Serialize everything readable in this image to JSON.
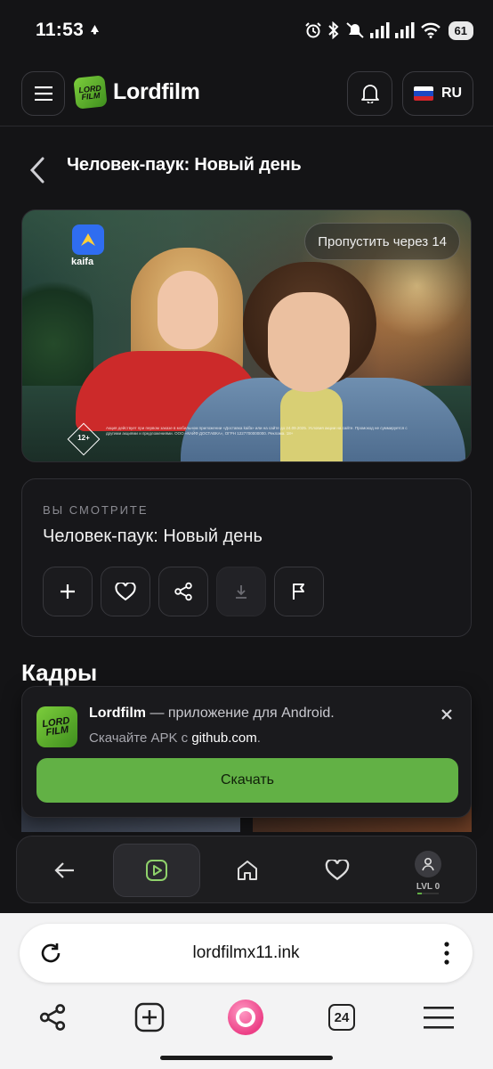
{
  "status_bar": {
    "time": "11:53",
    "battery": "61"
  },
  "header": {
    "logo_text": "Lordfilm",
    "logo_badge_line1": "LORD",
    "logo_badge_line2": "FILM",
    "language": "RU"
  },
  "page": {
    "title": "Человек-паук: Новый день"
  },
  "ad": {
    "brand": "kaifa",
    "skip_label": "Пропустить через 14",
    "age_rating": "12+",
    "disclaimer": "Акция действует при первом заказе в мобильном приложении «Доставка kaifa» или на сайте до 24.09.2025. Условия акции на сайте. Промокод не суммируется с другими акциями и предложениями. ООО «КАЙФ ДОСТАВКА», ОГРН 1227700000000. Реклама. 18+"
  },
  "watching": {
    "label": "ВЫ СМОТРИТЕ",
    "title": "Человек-паук: Новый день",
    "actions": [
      "add",
      "favorite",
      "share",
      "download",
      "report"
    ]
  },
  "frames": {
    "heading": "Кадры"
  },
  "app_banner": {
    "app_name": "Lordfilm",
    "tagline": " — приложение для Android.",
    "source_prefix": "Скачайте APK с ",
    "source": "github.com",
    "source_suffix": ".",
    "download_label": "Скачать"
  },
  "bottom_nav": {
    "items": [
      "back",
      "player",
      "home",
      "favorites",
      "profile"
    ],
    "active": "player",
    "level_label": "LVL 0",
    "level_progress": 0.2
  },
  "browser": {
    "url": "lordfilmx11.ink",
    "tabs_count": "24"
  },
  "colors": {
    "accent_green": "#62b145",
    "background": "#141416",
    "alice_pink": "#ec3f86"
  }
}
